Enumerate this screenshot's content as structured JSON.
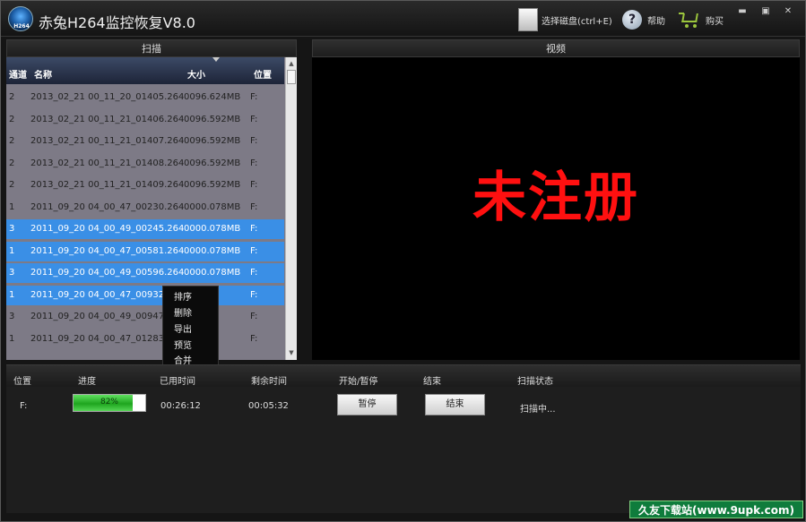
{
  "app": {
    "title": "赤兔H264监控恢复V8.0",
    "logo_text": "H264"
  },
  "toolbar": {
    "select_disk_label": "选择磁盘(ctrl+E)",
    "help_label": "帮助",
    "buy_label": "购买"
  },
  "window_controls": {
    "minimize": "▬",
    "maximize": "▣",
    "close": "✕"
  },
  "scan_panel": {
    "title": "扫描",
    "columns": [
      "通道",
      "名称",
      "大小",
      "位置"
    ],
    "rows": [
      {
        "channel": "2",
        "name": "2013_02_21 00_11_20_01405.264",
        "size": "0096.624MB",
        "pos": "F:",
        "selected": false
      },
      {
        "channel": "2",
        "name": "2013_02_21 00_11_21_01406.264",
        "size": "0096.592MB",
        "pos": "F:",
        "selected": false
      },
      {
        "channel": "2",
        "name": "2013_02_21 00_11_21_01407.264",
        "size": "0096.592MB",
        "pos": "F:",
        "selected": false
      },
      {
        "channel": "2",
        "name": "2013_02_21 00_11_21_01408.264",
        "size": "0096.592MB",
        "pos": "F:",
        "selected": false
      },
      {
        "channel": "2",
        "name": "2013_02_21 00_11_21_01409.264",
        "size": "0096.592MB",
        "pos": "F:",
        "selected": false
      },
      {
        "channel": "1",
        "name": "2011_09_20 04_00_47_00230.264",
        "size": "0000.078MB",
        "pos": "F:",
        "selected": false
      },
      {
        "channel": "3",
        "name": "2011_09_20 04_00_49_00245.264",
        "size": "0000.078MB",
        "pos": "F:",
        "selected": true
      },
      {
        "channel": "1",
        "name": "2011_09_20 04_00_47_00581.264",
        "size": "0000.078MB",
        "pos": "F:",
        "selected": true
      },
      {
        "channel": "3",
        "name": "2011_09_20 04_00_49_00596.264",
        "size": "0000.078MB",
        "pos": "F:",
        "selected": true
      },
      {
        "channel": "1",
        "name": "2011_09_20 04_00_47_00932.2",
        "size": "8MB",
        "pos": "F:",
        "selected": true
      },
      {
        "channel": "3",
        "name": "2011_09_20 04_00_49_00947.2",
        "size": "8MB",
        "pos": "F:",
        "selected": false
      },
      {
        "channel": "1",
        "name": "2011_09_20 04_00_47_01283.2",
        "size": "8MB",
        "pos": "F:",
        "selected": false
      }
    ],
    "scroll_up": "▲",
    "scroll_down": "▼"
  },
  "context_menu": {
    "items": [
      "排序",
      "删除",
      "导出",
      "预览",
      "合并"
    ]
  },
  "video_panel": {
    "title": "视频",
    "overlay_text": "未注册"
  },
  "task": {
    "headers": [
      "位置",
      "进度",
      "已用时间",
      "剩余时间",
      "开始/暂停",
      "结束",
      "扫描状态"
    ],
    "position": "F:",
    "progress_text": "82%",
    "progress_fraction": 0.82,
    "elapsed": "00:26:12",
    "remaining": "00:05:32",
    "pause_label": "暂停",
    "stop_label": "结束",
    "status": "扫描中..."
  },
  "watermark": {
    "text": "久友下载站(www.9upk.com)"
  }
}
